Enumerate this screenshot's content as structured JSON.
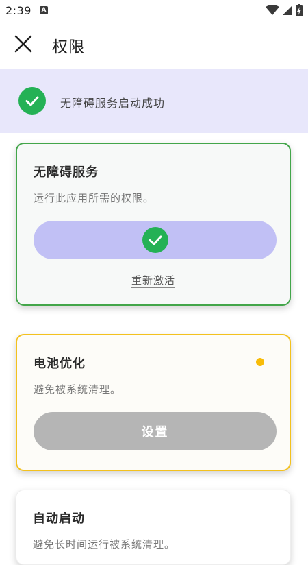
{
  "status_bar": {
    "time": "2:39",
    "notification_icon": "a-icon",
    "icons": [
      "wifi-icon",
      "signal-icon",
      "battery-charging-icon"
    ]
  },
  "app_bar": {
    "close_icon": "close-icon",
    "title": "权限"
  },
  "banner": {
    "icon": "check-circle-icon",
    "text": "无障碍服务启动成功",
    "background": "#e8e7fb",
    "icon_color": "#24b155"
  },
  "cards": {
    "accessibility": {
      "title": "无障碍服务",
      "description": "运行此应用所需的权限。",
      "button_icon": "check-circle-icon",
      "link_label": "重新激活",
      "border_color": "#43a64a",
      "button_color": "#c1c0f5"
    },
    "battery": {
      "title": "电池优化",
      "description": "避免被系统清理。",
      "button_label": "设置",
      "status_dot_color": "#f8bc09",
      "border_color": "#f3c11e",
      "button_color": "#b5b5b5"
    },
    "autostart": {
      "title": "自动启动",
      "description": "避免长时间运行被系统清理。"
    }
  }
}
